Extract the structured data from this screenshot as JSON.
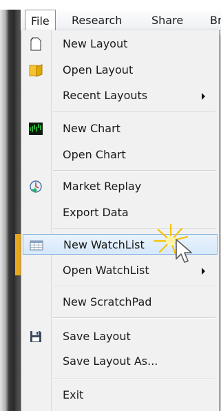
{
  "menubar": {
    "items": [
      {
        "label": "File",
        "active": true
      },
      {
        "label": "Research"
      },
      {
        "label": "Share"
      },
      {
        "label": "Br"
      }
    ]
  },
  "file_menu": {
    "items": [
      {
        "label": "New Layout",
        "icon": "blank-page-icon"
      },
      {
        "label": "Open Layout",
        "icon": "folder-icon"
      },
      {
        "label": "Recent Layouts",
        "submenu": true
      },
      {
        "label": "New Chart",
        "icon": "chart-icon"
      },
      {
        "label": "Open Chart"
      },
      {
        "label": "Market Replay",
        "icon": "market-replay-icon"
      },
      {
        "label": "Export Data"
      },
      {
        "label": "New WatchList",
        "icon": "watchlist-icon",
        "highlighted": true
      },
      {
        "label": "Open WatchList",
        "submenu": true
      },
      {
        "label": "New ScratchPad"
      },
      {
        "label": "Save Layout",
        "icon": "floppy-disk-icon"
      },
      {
        "label": "Save Layout As..."
      },
      {
        "label": "Exit"
      }
    ]
  },
  "colors": {
    "highlight_border": "#8fb6e3",
    "highlight_fill": "#d6e8fb",
    "burst": "#f5c400",
    "app_accent": "#e8a91c"
  }
}
